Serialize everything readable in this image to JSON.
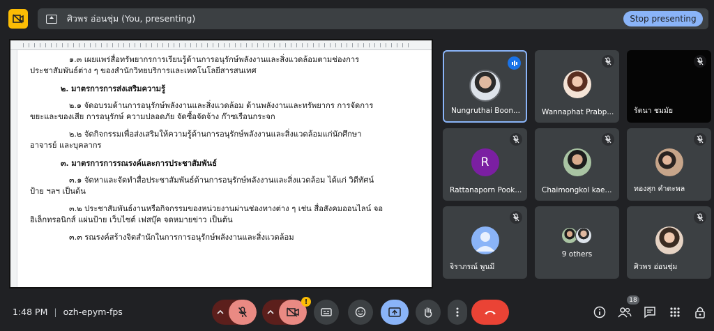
{
  "presentation": {
    "banner_text": "ศิวพร อ่อนชุ่ม (You, presenting)",
    "stop_label": "Stop presenting"
  },
  "document": {
    "paragraphs": [
      "๑.๓ เผยแพร่สื่อทรัพยากรการเรียนรู้ด้านการอนุรักษ์พลังงานและสิ่งแวดล้อมตามช่องการ",
      "ประชาสัมพันธ์ต่าง ๆ ของสำนักวิทยบริการและเทคโนโลยีสารสนเทศ",
      "๒. มาตรการการส่งเสริมความรู้",
      "๒.๑ จัดอบรมด้านการอนุรักษ์พลังงานและสิ่งแวดล้อม ด้านพลังงานและทรัพยากร การจัดการ",
      "ขยะและของเสีย การอนุรักษ์ ความปลอดภัย จัดซื้อจัดจ้าง ก๊าซเรือนกระจก",
      "๒.๒ จัดกิจกรรมเพื่อส่งเสริมให้ความรู้ด้านการอนุรักษ์พลังงานและสิ่งแวดล้อมแก่นักศึกษา",
      "อาจารย์ และบุคลากร",
      "๓. มาตรการการรณรงค์และการประชาสัมพันธ์",
      "๓.๑ จัดหาและจัดทำสื่อประชาสัมพันธ์ด้านการอนุรักษ์พลังงานและสิ่งแวดล้อม ได้แก่ วิดีทัศน์",
      "ป้าย ฯลฯ เป็นต้น",
      "๓.๒ ประชาสัมพันธ์งานหรือกิจกรรมของหน่วยงานผ่านช่องทางต่าง ๆ เช่น สื่อสังคมออนไลน์ จอ",
      "อิเล็กทรอนิกส์ แผ่นป้าย เว็บไซต์ เฟสบุ๊ค จดหมายข่าว เป็นต้น",
      "๓.๓ รณรงค์สร้างจิตสำนักในการการอนุรักษ์พลังงานและสิ่งแวดล้อม"
    ]
  },
  "participants": [
    {
      "name": "Nungruthai Boon...",
      "avatar": "photo",
      "speaking": true
    },
    {
      "name": "Wannaphat Prabp...",
      "avatar": "photo",
      "muted": true
    },
    {
      "name": "รัตนา ชมมัย",
      "avatar": "none",
      "muted": true
    },
    {
      "name": "Rattanaporn Pook...",
      "avatar": "initial",
      "initial": "R",
      "muted": true
    },
    {
      "name": "Chaimongkol kae...",
      "avatar": "photo",
      "muted": true
    },
    {
      "name": "ทองสุก คำตะพล",
      "avatar": "photo",
      "muted": true
    },
    {
      "name": "จิราภรณ์ พูนมี",
      "avatar": "generic",
      "muted": true
    },
    {
      "name": "9 others",
      "avatar": "stack"
    },
    {
      "name": "ศิวพร อ่อนชุ่ม",
      "avatar": "photo",
      "muted": true
    }
  ],
  "meeting": {
    "time": "1:48 PM",
    "code": "ozh-epym-fps",
    "people_count": "18",
    "warning_badge": "!"
  },
  "colors": {
    "background": "#202124",
    "tile": "#3c4043",
    "accent_blue": "#8ab4f8",
    "end_call_red": "#ea4335",
    "muted_red": "#ea8a83",
    "warning_yellow": "#fbbc04"
  },
  "icons": {
    "top_left": "camera-off-icon",
    "presenting": "present-to-all-icon",
    "toolbar": [
      "caret-up-icon",
      "mic-off-icon",
      "caret-up-icon",
      "camera-off-icon",
      "captions-icon",
      "emoji-icon",
      "present-to-all-icon",
      "raise-hand-icon",
      "more-vert-icon",
      "call-end-icon"
    ],
    "right": [
      "info-icon",
      "people-icon",
      "chat-icon",
      "apps-icon",
      "host-controls-icon"
    ]
  }
}
